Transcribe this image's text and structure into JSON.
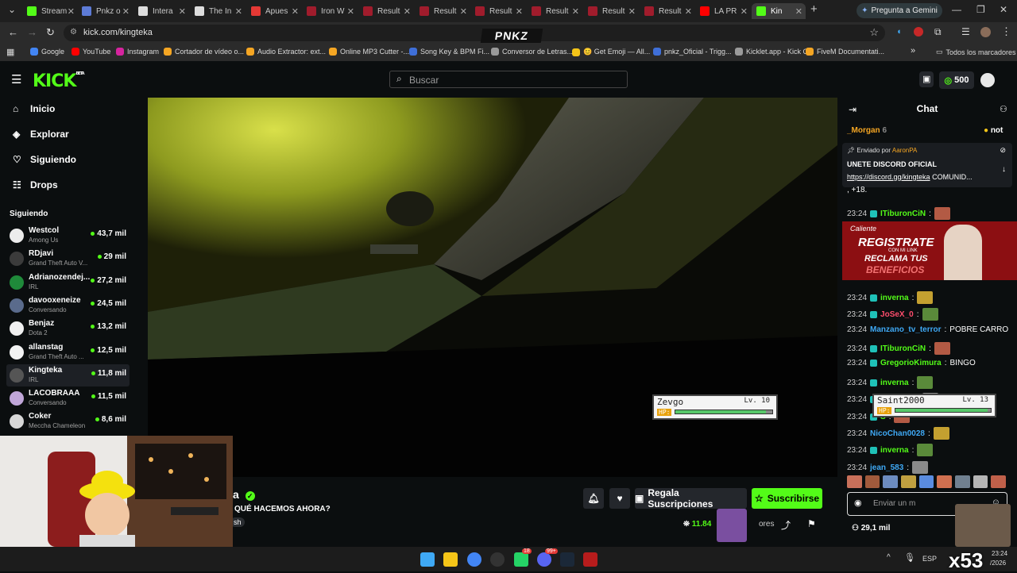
{
  "browser": {
    "tabs": [
      {
        "label": "Stream",
        "color": "#53fc18"
      },
      {
        "label": "Pnkz o",
        "color": "#5d7bd6"
      },
      {
        "label": "Intera",
        "color": "#dddddd"
      },
      {
        "label": "The In",
        "color": "#dddddd"
      },
      {
        "label": "Apues",
        "color": "#e53935"
      },
      {
        "label": "Iron W",
        "color": "#a01c2c"
      },
      {
        "label": "Result",
        "color": "#a01c2c"
      },
      {
        "label": "Result",
        "color": "#a01c2c"
      },
      {
        "label": "Result",
        "color": "#a01c2c"
      },
      {
        "label": "Result",
        "color": "#a01c2c"
      },
      {
        "label": "Result",
        "color": "#a01c2c"
      },
      {
        "label": "Result",
        "color": "#a01c2c"
      },
      {
        "label": "LA PR",
        "color": "#ff0000"
      },
      {
        "label": "Kin",
        "color": "#53fc18"
      }
    ],
    "gemini_label": "Pregunta a Gemini",
    "url": "kick.com/kingteka",
    "extension_label": "PNKZ",
    "bookmarks": [
      {
        "label": "Google",
        "color": "#4285f4"
      },
      {
        "label": "YouTube",
        "color": "#ff0000"
      },
      {
        "label": "Instagram",
        "color": "#d6249f"
      },
      {
        "label": "Cortador de vídeo o...",
        "color": "#f5a623"
      },
      {
        "label": "Audio Extractor: ext...",
        "color": "#f5a623"
      },
      {
        "label": "Online MP3 Cutter -...",
        "color": "#f5a623"
      },
      {
        "label": "Song Key & BPM Fi...",
        "color": "#3f6fd8"
      },
      {
        "label": "Conversor de Letras...",
        "color": "#9a9a9a"
      },
      {
        "label": "😊 Get Emoji — All...",
        "color": "#f5c518"
      },
      {
        "label": "pnkz_Oficial - Trigg...",
        "color": "#3f6fd8"
      },
      {
        "label": "Kicklet.app - Kick C...",
        "color": "#9a9a9a"
      },
      {
        "label": "FiveM Documentati...",
        "color": "#f5a623"
      }
    ],
    "all_bookmarks_label": "Todos los marcadores"
  },
  "kick": {
    "logo": "KICK",
    "logo_sup": "BETA",
    "search_placeholder": "Buscar",
    "points": "500",
    "nav": [
      {
        "label": "Inicio",
        "icon": "home-icon"
      },
      {
        "label": "Explorar",
        "icon": "compass-icon"
      },
      {
        "label": "Siguiendo",
        "icon": "heart-icon"
      },
      {
        "label": "Drops",
        "icon": "drops-icon"
      }
    ],
    "following_title": "Siguiendo",
    "following": [
      {
        "name": "Westcol",
        "category": "Among Us",
        "viewers": "43,7 mil",
        "color": "#ececec"
      },
      {
        "name": "RDjavi",
        "category": "Grand Theft Auto V...",
        "viewers": "29 mil",
        "color": "#3b3b3b"
      },
      {
        "name": "Adrianozendej...",
        "category": "IRL",
        "viewers": "27,2 mil",
        "color": "#1f8a3a"
      },
      {
        "name": "davooxeneize",
        "category": "Conversando",
        "viewers": "24,5 mil",
        "color": "#5a6b8c"
      },
      {
        "name": "Benjaz",
        "category": "Dota 2",
        "viewers": "13,2 mil",
        "color": "#f0f0f0"
      },
      {
        "name": "allanstag",
        "category": "Grand Theft Auto ...",
        "viewers": "12,5 mil",
        "color": "#f3f3f3"
      },
      {
        "name": "Kingteka",
        "category": "IRL",
        "viewers": "11,8 mil",
        "color": "#555555"
      },
      {
        "name": "LACOBRAAA",
        "category": "Conversando",
        "viewers": "11,5 mil",
        "color": "#c0a6d8"
      },
      {
        "name": "Coker",
        "category": "Meccha Chameleon",
        "viewers": "8,6 mil",
        "color": "#d7d7d7"
      }
    ],
    "stream": {
      "title_partial": "a",
      "subtitle": "QUÉ HACEMOS AHORA?",
      "tag_partial": "sh",
      "gift_label": "Regala Suscripciones",
      "subscribe_label": "Suscribirse",
      "viewers": "11.84",
      "extra_label": "ores"
    },
    "overlay": {
      "p1_name": "Zevgo",
      "p1_level": "Lv. 10",
      "p1_hp_label": "HP:",
      "p1_hp": 0.92,
      "p2_name": "Saint2000",
      "p2_level": "Lv. 13",
      "p2_hp_label": "HP:",
      "p2_hp": 0.95
    },
    "chat": {
      "title": "Chat",
      "top_user": "_Morgan",
      "top_count": "6",
      "top_right": "not",
      "pinned_by": "Enviado por",
      "pinned_user": "AaronPA",
      "pinned_title": "UNETE DISCORD OFICIAL",
      "pinned_link": "https://discord.gg/kingteka",
      "pinned_trail": "COMUNID...",
      "partial_line": ", +18.",
      "ad_line1": "REGISTRATE",
      "ad_line2": "CON MI LINK",
      "ad_line3": "RECLAMA TUS",
      "ad_line4": "BENEFICIOS",
      "ad_brand": "Caliente",
      "messages": [
        {
          "time": "23:24",
          "user": "ITiburonCiN",
          "text": "",
          "color": "#53fc18"
        },
        {
          "time": "23:24",
          "user": "inverna",
          "text": "",
          "color": "#53fc18"
        },
        {
          "time": "23:24",
          "user": "JoSeX_0",
          "text": "",
          "color": "#ff4d6d"
        },
        {
          "time": "23:24",
          "user": "Manzano_tv_terror",
          "text": "POBRE CARRO",
          "color": "#3fa9f5"
        },
        {
          "time": "23:24",
          "user": "ITiburonCiN",
          "text": "",
          "color": "#53fc18"
        },
        {
          "time": "23:24",
          "user": "GregorioKimura",
          "text": "BINGO",
          "color": "#53fc18"
        },
        {
          "time": "23:24",
          "user": "inverna",
          "text": "",
          "color": "#53fc18"
        },
        {
          "time": "23:24",
          "user": "JoSeX_0",
          "text": "",
          "color": "#ff4d6d"
        },
        {
          "time": "23:24",
          "user": "S",
          "text": "",
          "color": "#53fc18"
        },
        {
          "time": "23:24",
          "user": "NicoChan0028",
          "text": "",
          "color": "#3fa9f5"
        },
        {
          "time": "23:24",
          "user": "inverna",
          "text": "",
          "color": "#53fc18"
        },
        {
          "time": "23:24",
          "user": "jean_583",
          "text": "",
          "color": "#3fa9f5"
        }
      ],
      "input_placeholder": "Enviar un m",
      "viewers_count": "29,1 mil",
      "send_partial": "at"
    }
  },
  "taskbar": {
    "lang": "ESP",
    "time": "23:24",
    "date": "/2026",
    "overlay_text": "x53",
    "badge1": "18",
    "badge2": "99+"
  }
}
